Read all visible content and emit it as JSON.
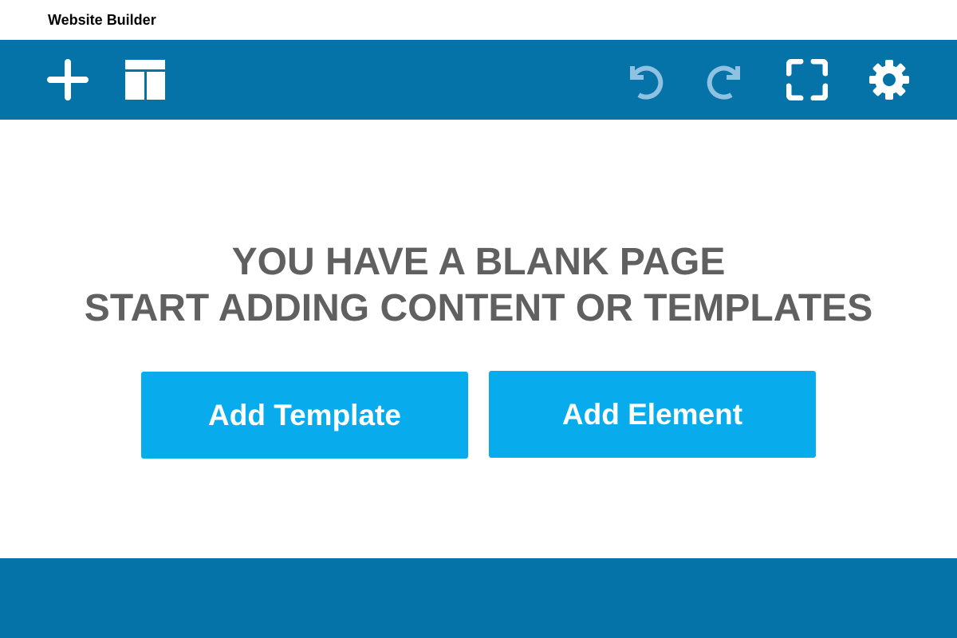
{
  "app": {
    "title": "Website Builder"
  },
  "toolbar": {
    "left_icons": [
      {
        "name": "plus-icon",
        "label": "Add"
      },
      {
        "name": "layout-icon",
        "label": "Layout"
      }
    ],
    "right_icons": [
      {
        "name": "undo-icon",
        "label": "Undo",
        "state": "disabled"
      },
      {
        "name": "redo-icon",
        "label": "Redo",
        "state": "disabled"
      },
      {
        "name": "fullscreen-icon",
        "label": "Fullscreen",
        "state": "enabled"
      },
      {
        "name": "gear-icon",
        "label": "Settings",
        "state": "enabled"
      }
    ]
  },
  "main": {
    "message_line1": "YOU HAVE A BLANK PAGE",
    "message_line2": "START ADDING CONTENT OR TEMPLATES",
    "add_template_label": "Add Template",
    "add_element_label": "Add Element"
  },
  "colors": {
    "toolbar_bg": "#0572A8",
    "button_bg": "#08ACEC",
    "message_text": "#606060",
    "icon_active": "#FFFFFF",
    "icon_disabled": "#8FC2E0"
  }
}
